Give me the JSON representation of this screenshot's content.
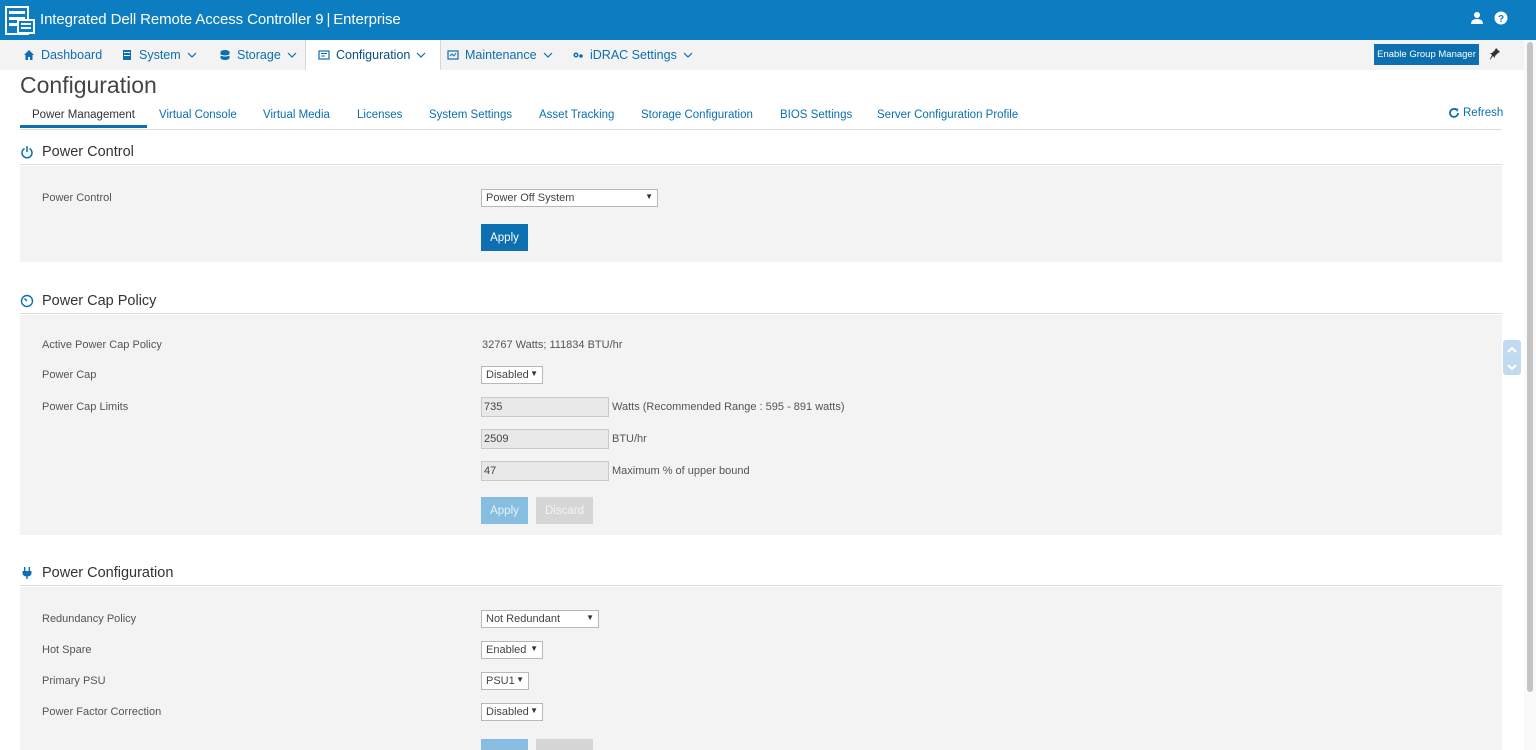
{
  "app": {
    "title": "Integrated Dell Remote Access Controller 9",
    "edition": "Enterprise",
    "separator": "|"
  },
  "nav": {
    "items": [
      {
        "label": "Dashboard",
        "icon": "home-icon"
      },
      {
        "label": "System",
        "icon": "server-icon"
      },
      {
        "label": "Storage",
        "icon": "storage-icon"
      },
      {
        "label": "Configuration",
        "icon": "configuration-icon"
      },
      {
        "label": "Maintenance",
        "icon": "maintenance-icon"
      },
      {
        "label": "iDRAC Settings",
        "icon": "gears-icon"
      }
    ],
    "active": "Configuration",
    "enable_group_manager": "Enable Group Manager"
  },
  "page": {
    "title": "Configuration",
    "refresh": "Refresh"
  },
  "subtabs": [
    "Power Management",
    "Virtual Console",
    "Virtual Media",
    "Licenses",
    "System Settings",
    "Asset Tracking",
    "Storage Configuration",
    "BIOS Settings",
    "Server Configuration Profile"
  ],
  "power_control": {
    "heading": "Power Control",
    "label": "Power Control",
    "selected": "Power Off System",
    "apply": "Apply"
  },
  "power_cap_policy": {
    "heading": "Power Cap Policy",
    "active_label": "Active Power Cap Policy",
    "active_value": "32767 Watts; 111834 BTU/hr",
    "cap_label": "Power Cap",
    "cap_value": "Disabled",
    "limits_label": "Power Cap Limits",
    "watts": "735",
    "watts_unit": "Watts (Recommended Range : 595 - 891 watts)",
    "btu": "2509",
    "btu_unit": "BTU/hr",
    "percent": "47",
    "percent_unit": "Maximum % of upper bound",
    "apply": "Apply",
    "discard": "Discard"
  },
  "power_configuration": {
    "heading": "Power Configuration",
    "redundancy_label": "Redundancy Policy",
    "redundancy_value": "Not Redundant",
    "hot_spare_label": "Hot Spare",
    "hot_spare_value": "Enabled",
    "primary_psu_label": "Primary PSU",
    "primary_psu_value": "PSU1",
    "pfc_label": "Power Factor Correction",
    "pfc_value": "Disabled"
  },
  "colors": {
    "brand": "#0b7dc0",
    "link": "#0b6fb0",
    "panel": "#f3f3f3"
  }
}
